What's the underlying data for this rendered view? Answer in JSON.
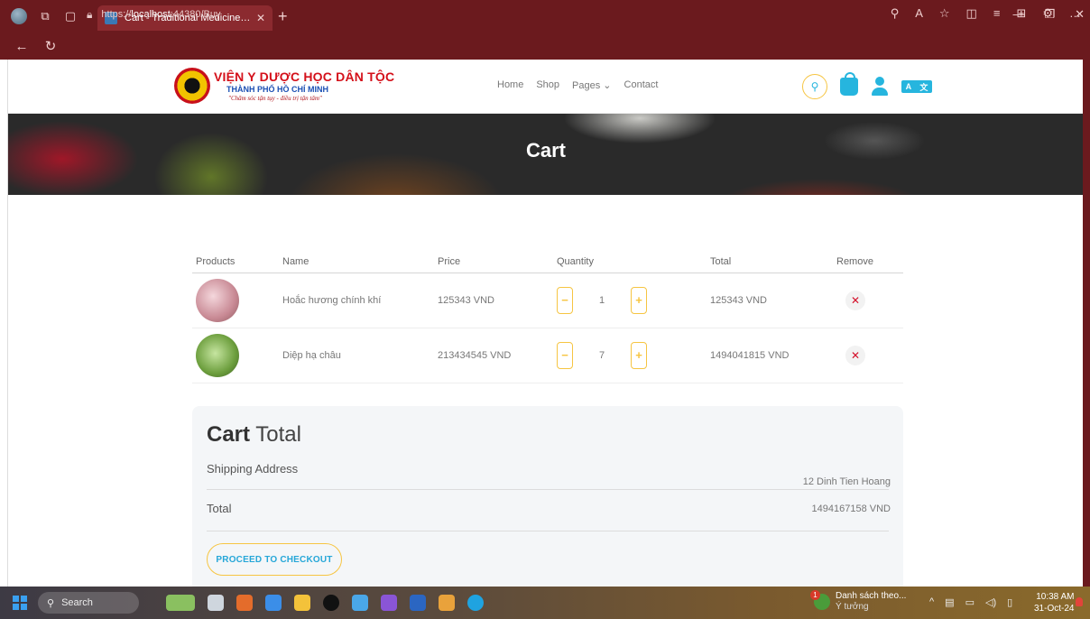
{
  "browser": {
    "tab_title": "Cart - Traditional Medicine Hospi",
    "tab_close": "✕",
    "new_tab": "+",
    "url_scheme": "https://",
    "url_host": "localhost",
    "url_rest": ":44380/Buy"
  },
  "site": {
    "logo_line1": "VIỆN Y DƯỢC HỌC DÂN TỘC",
    "logo_line2": "THÀNH PHỐ HỒ CHÍ MINH",
    "logo_line3": "\"Chăm sóc tận tụy - điều trị tận tâm\"",
    "nav": [
      "Home",
      "Shop",
      "Pages ⌄",
      "Contact"
    ],
    "lang_label": [
      "A",
      "文"
    ]
  },
  "hero": {
    "title": "Cart"
  },
  "cart": {
    "headers": [
      "Products",
      "Name",
      "Price",
      "Quantity",
      "Total",
      "Remove"
    ],
    "rows": [
      {
        "name": "Hoắc hương chính khí",
        "price": "125343 VND",
        "quantity": "1",
        "total": "125343 VND"
      },
      {
        "name": "Diệp hạ châu",
        "price": "213434545 VND",
        "quantity": "7",
        "total": "1494041815 VND"
      }
    ],
    "minus": "−",
    "plus": "+",
    "remove": "✕"
  },
  "cart_total": {
    "title_bold": "Cart",
    "title_rest": " Total",
    "shipping_label": "Shipping Address",
    "shipping_value": "12 Dinh Tien Hoang",
    "total_label": "Total",
    "total_value": "1494167158 VND",
    "checkout_label": "PROCEED TO CHECKOUT"
  },
  "taskbar": {
    "search_label": "Search",
    "news_badge": "1",
    "news_title": "Danh sách theo...",
    "news_sub": "Ý tưởng",
    "time": "10:38 AM",
    "date": "31-Oct-24"
  }
}
